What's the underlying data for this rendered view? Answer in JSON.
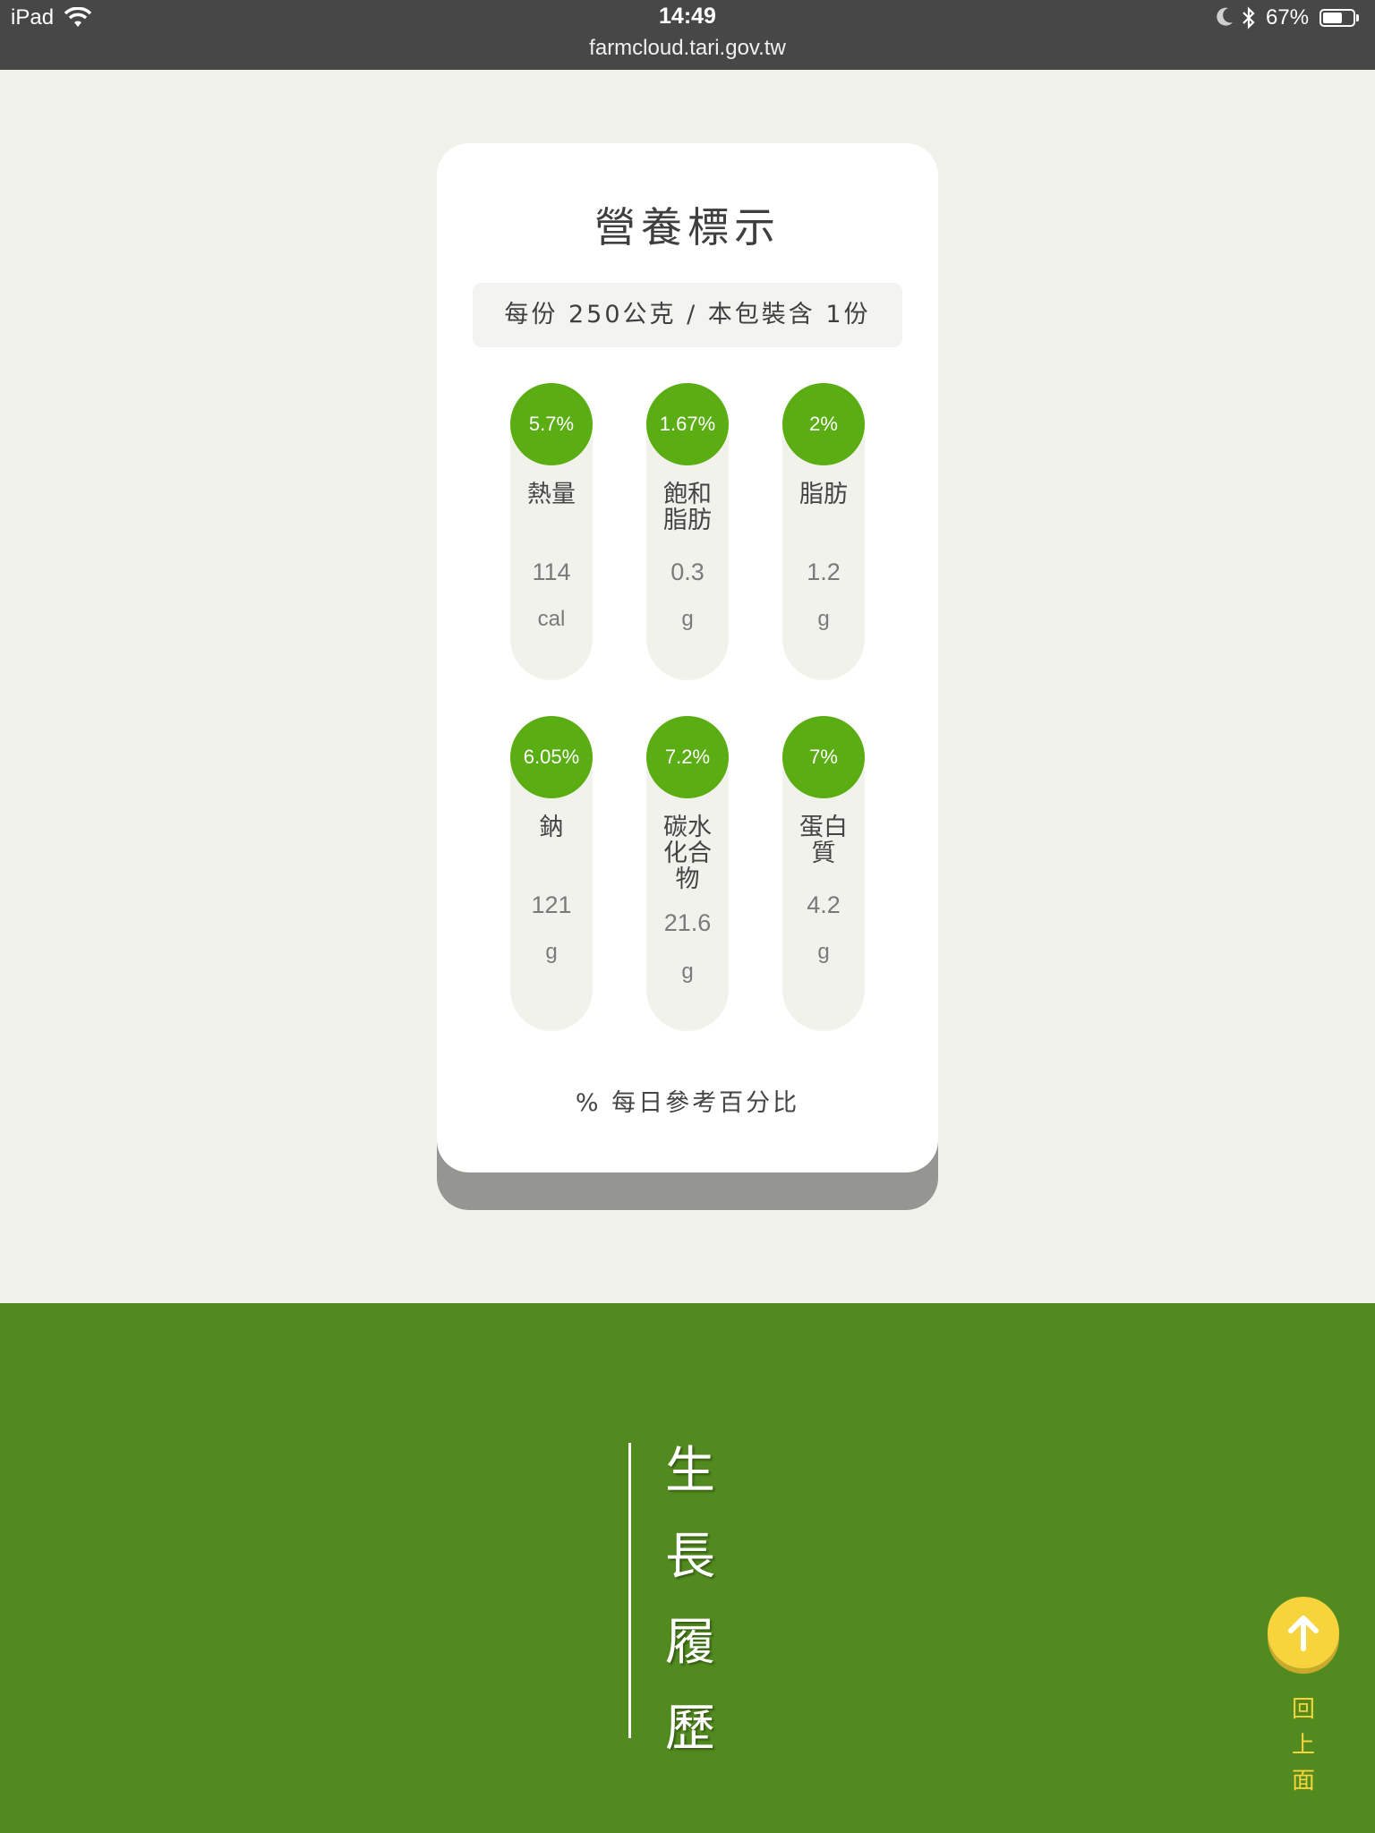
{
  "status_bar": {
    "device": "iPad",
    "time": "14:49",
    "url": "farmcloud.tari.gov.tw",
    "battery_percent_label": "67%",
    "battery_level": 0.67
  },
  "nutrition_card": {
    "title": "營養標示",
    "serving": "每份 250公克 / 本包裝含 1份",
    "nutrients": [
      {
        "pct": "5.7%",
        "name": "熱量",
        "value": "114",
        "unit": "cal"
      },
      {
        "pct": "1.67%",
        "name": "飽和脂肪",
        "value": "0.3",
        "unit": "g"
      },
      {
        "pct": "2%",
        "name": "脂肪",
        "value": "1.2",
        "unit": "g"
      },
      {
        "pct": "6.05%",
        "name": "鈉",
        "value": "121",
        "unit": "g"
      },
      {
        "pct": "7.2%",
        "name": "碳水化合物",
        "value": "21.6",
        "unit": "g"
      },
      {
        "pct": "7%",
        "name": "蛋白質",
        "value": "4.2",
        "unit": "g"
      }
    ],
    "footnote": "% 每日參考百分比"
  },
  "growth_section": {
    "title_chars": [
      "生",
      "長",
      "履",
      "歷"
    ]
  },
  "back_to_top": {
    "label_chars": [
      "回",
      "上",
      "面"
    ]
  },
  "colors": {
    "accent_green": "#5aad12",
    "section_green": "#518a1e",
    "button_yellow": "#f7d33c"
  }
}
